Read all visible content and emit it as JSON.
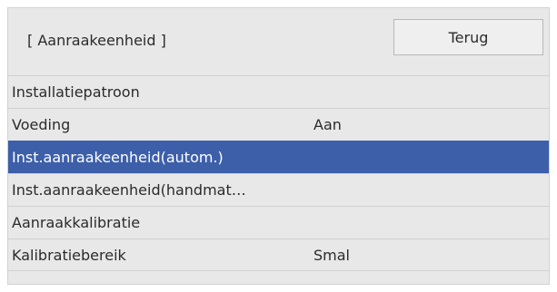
{
  "header": {
    "title": "[ Aanraakeenheid ]",
    "back_label": "Terug"
  },
  "menu": {
    "items": [
      {
        "label": "Installatiepatroon",
        "value": ""
      },
      {
        "label": "Voeding",
        "value": "Aan"
      },
      {
        "label": "Inst.aanraakeenheid(autom.)",
        "value": "",
        "selected": true
      },
      {
        "label": "Inst.aanraakeenheid(handmat…",
        "value": ""
      },
      {
        "label": "Aanraakkalibratie",
        "value": ""
      },
      {
        "label": "Kalibratiebereik",
        "value": "Smal"
      }
    ]
  },
  "colors": {
    "panel_background": "#e8e8e8",
    "selection": "#3d5fa9",
    "text": "#2b2b2b"
  }
}
